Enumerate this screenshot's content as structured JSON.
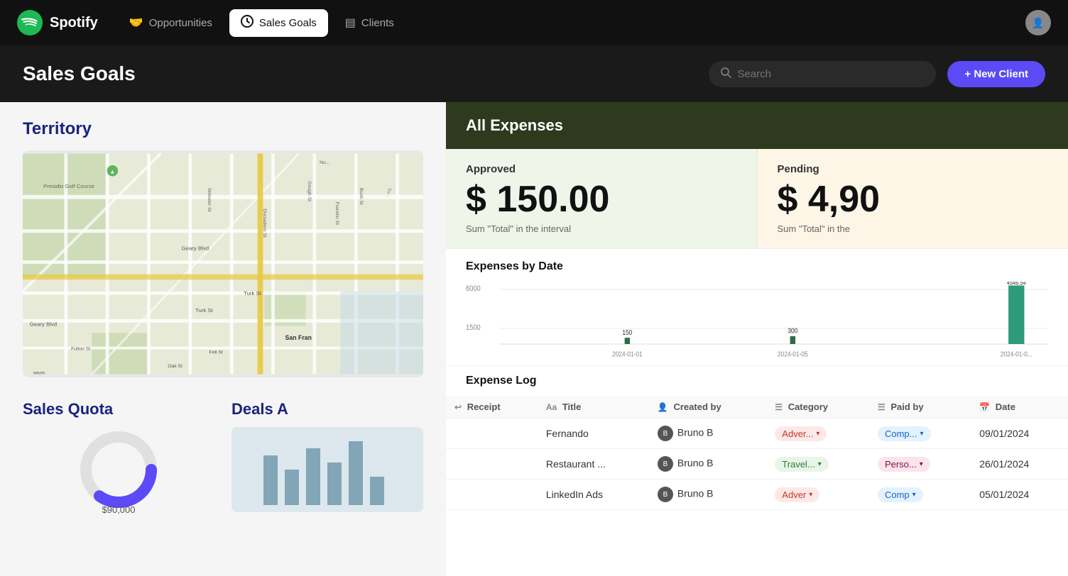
{
  "nav": {
    "logo": "Spotify",
    "items": [
      {
        "label": "Opportunities",
        "icon": "🤝",
        "active": false
      },
      {
        "label": "Sales Goals",
        "icon": "●",
        "active": true
      },
      {
        "label": "Clients",
        "icon": "▤",
        "active": false
      }
    ]
  },
  "header": {
    "title": "Sales Goals",
    "search_placeholder": "Search",
    "new_client_label": "+ New Client"
  },
  "left": {
    "territory_title": "Territory",
    "sales_quota_title": "Sales Quota",
    "quota_amount": "$90,000",
    "deals_title": "Deals A"
  },
  "expenses": {
    "title": "All Expenses",
    "approved_label": "Approved",
    "approved_amount": "$ 150.00",
    "approved_sub": "Sum \"Total\" in the interval",
    "pending_label": "Pending",
    "pending_amount": "$ 4,90",
    "pending_sub": "Sum \"Total\" in the",
    "chart_title": "Expenses by Date",
    "chart_y_labels": [
      "6000",
      "1500"
    ],
    "chart_points": [
      {
        "date": "2024-01-01",
        "value": 150,
        "label": "150"
      },
      {
        "date": "2024-01-05",
        "value": 300,
        "label": "300"
      },
      {
        "date": "2024-01-0?",
        "value": 4546.54,
        "label": "4546.54"
      }
    ],
    "table_title": "Expense Log",
    "table_headers": [
      "Receipt",
      "Title",
      "Created by",
      "Category",
      "Paid by",
      "Date"
    ],
    "table_header_icons": [
      "↩",
      "Aa",
      "👤",
      "☰",
      "☰",
      "📅"
    ],
    "rows": [
      {
        "receipt": "",
        "title": "Fernando",
        "created_by": "Bruno B",
        "category": "Adver...",
        "category_type": "adver",
        "paid_by": "Comp...",
        "paid_type": "comp",
        "date": "09/01/2024"
      },
      {
        "receipt": "",
        "title": "Restaurant ...",
        "created_by": "Bruno B",
        "category": "Travel...",
        "category_type": "travel",
        "paid_by": "Perso...",
        "paid_type": "perso",
        "date": "26/01/2024"
      },
      {
        "receipt": "",
        "title": "LinkedIn Ads",
        "created_by": "Bruno B",
        "category": "Adver",
        "category_type": "adver",
        "paid_by": "Comp",
        "paid_type": "comp",
        "date": "05/01/2024"
      }
    ]
  }
}
